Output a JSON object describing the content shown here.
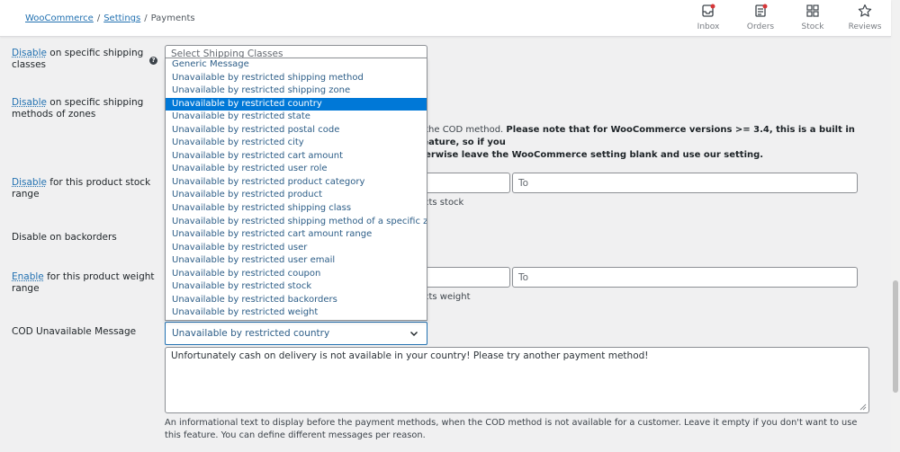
{
  "header": {
    "breadcrumb": {
      "woocommerce": "WooCommerce",
      "settings": "Settings",
      "current": "Payments",
      "sep": "/"
    },
    "actions": [
      {
        "label": "Inbox",
        "icon": "inbox-icon"
      },
      {
        "label": "Orders",
        "icon": "orders-icon"
      },
      {
        "label": "Stock",
        "icon": "stock-icon"
      },
      {
        "label": "Reviews",
        "icon": "reviews-icon"
      }
    ]
  },
  "fields": {
    "shipping_classes": {
      "kw": "Disable",
      "rest": " on specific shipping classes",
      "placeholder": "Select Shipping Classes"
    },
    "shipping_methods": {
      "kw": "Disable",
      "rest": " on specific shipping methods of zones",
      "desc_line1_pre": "t the COD method. ",
      "desc_line1_bold": "Please note that for WooCommerce versions >= 3.4, this is a built in feature, so if you",
      "desc_line2_bold": "herwise leave the WooCommerce setting blank and use our setting."
    },
    "stock_range": {
      "kw": "Disable",
      "rest": " for this product stock range",
      "to_placeholder": "To",
      "desc": "cts stock"
    },
    "backorders": {
      "label": "Disable on backorders"
    },
    "weight_range": {
      "kw": "Enable",
      "rest": " for this product weight range",
      "to_placeholder": "To",
      "desc": "cts weight"
    },
    "cod_message": {
      "label": "COD Unavailable Message",
      "selected": "Unavailable by restricted country",
      "textarea": "Unfortunately cash on delivery is not available in your country! Please try another payment method!",
      "desc": "An informational text to display before the payment methods, when the COD method is not available for a customer. Leave it empty if you don't want to use this feature. You can define different messages per reason."
    }
  },
  "dropdown": {
    "options": [
      "Generic Message",
      "Unavailable by restricted shipping method",
      "Unavailable by restricted shipping zone",
      "Unavailable by restricted country",
      "Unavailable by restricted state",
      "Unavailable by restricted postal code",
      "Unavailable by restricted city",
      "Unavailable by restricted cart amount",
      "Unavailable by restricted user role",
      "Unavailable by restricted product category",
      "Unavailable by restricted product",
      "Unavailable by restricted shipping class",
      "Unavailable by restricted shipping method of a specific zone",
      "Unavailable by restricted cart amount range",
      "Unavailable by restricted user",
      "Unavailable by restricted user email",
      "Unavailable by restricted coupon",
      "Unavailable by restricted stock",
      "Unavailable by restricted backorders",
      "Unavailable by restricted weight"
    ],
    "selected_index": 3
  },
  "colors": {
    "link": "#2271b1",
    "highlight": "#0078d7"
  }
}
